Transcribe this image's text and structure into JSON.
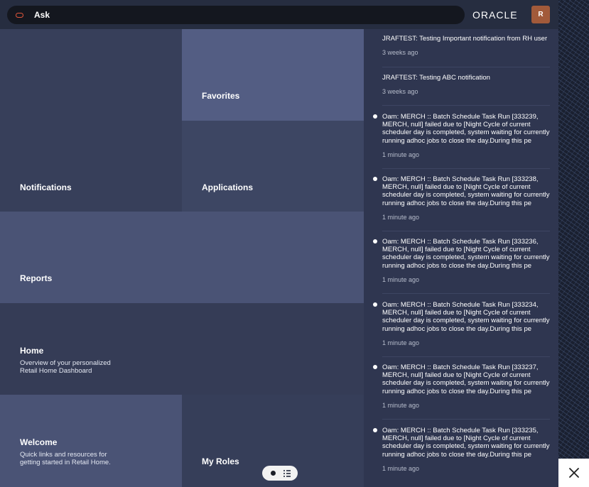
{
  "header": {
    "ask_label": "Ask",
    "logo_text": "ORACLE",
    "avatar_initial": "R"
  },
  "tiles": {
    "notifications": {
      "label": "Notifications"
    },
    "favorites": {
      "label": "Favorites"
    },
    "applications": {
      "label": "Applications"
    },
    "reports": {
      "label": "Reports"
    },
    "home": {
      "label": "Home",
      "description": "Overview of your personalized Retail Home Dashboard"
    },
    "welcome": {
      "label": "Welcome",
      "description": "Quick links and resources for getting started in Retail Home."
    },
    "my_roles": {
      "label": "My Roles"
    }
  },
  "notifications": [
    {
      "title": "JRAFTEST: Testing Important notification from RH user",
      "time": "3 weeks ago",
      "unread": false
    },
    {
      "title": "JRAFTEST: Testing ABC notification",
      "time": "3 weeks ago",
      "unread": false
    },
    {
      "title": "Oam: MERCH :: Batch Schedule Task Run [333239, MERCH, null] failed due to [Night Cycle of current scheduler day is completed, system waiting for currently running adhoc jobs to close the day.During this pe",
      "time": "1 minute ago",
      "unread": true
    },
    {
      "title": "Oam: MERCH :: Batch Schedule Task Run [333238, MERCH, null] failed due to [Night Cycle of current scheduler day is completed, system waiting for currently running adhoc jobs to close the day.During this pe",
      "time": "1 minute ago",
      "unread": true
    },
    {
      "title": "Oam: MERCH :: Batch Schedule Task Run [333236, MERCH, null] failed due to [Night Cycle of current scheduler day is completed, system waiting for currently running adhoc jobs to close the day.During this pe",
      "time": "1 minute ago",
      "unread": true
    },
    {
      "title": "Oam: MERCH :: Batch Schedule Task Run [333234, MERCH, null] failed due to [Night Cycle of current scheduler day is completed, system waiting for currently running adhoc jobs to close the day.During this pe",
      "time": "1 minute ago",
      "unread": true
    },
    {
      "title": "Oam: MERCH :: Batch Schedule Task Run [333237, MERCH, null] failed due to [Night Cycle of current scheduler day is completed, system waiting for currently running adhoc jobs to close the day.During this pe",
      "time": "1 minute ago",
      "unread": true
    },
    {
      "title": "Oam: MERCH :: Batch Schedule Task Run [333235, MERCH, null] failed due to [Night Cycle of current scheduler day is completed, system waiting for currently running adhoc jobs to close the day.During this pe",
      "time": "1 minute ago",
      "unread": true
    }
  ],
  "icons": {
    "ask": "ask-oracle-icon",
    "close": "close-icon",
    "dot_view": "dot-view-icon",
    "list_view": "list-view-icon"
  }
}
